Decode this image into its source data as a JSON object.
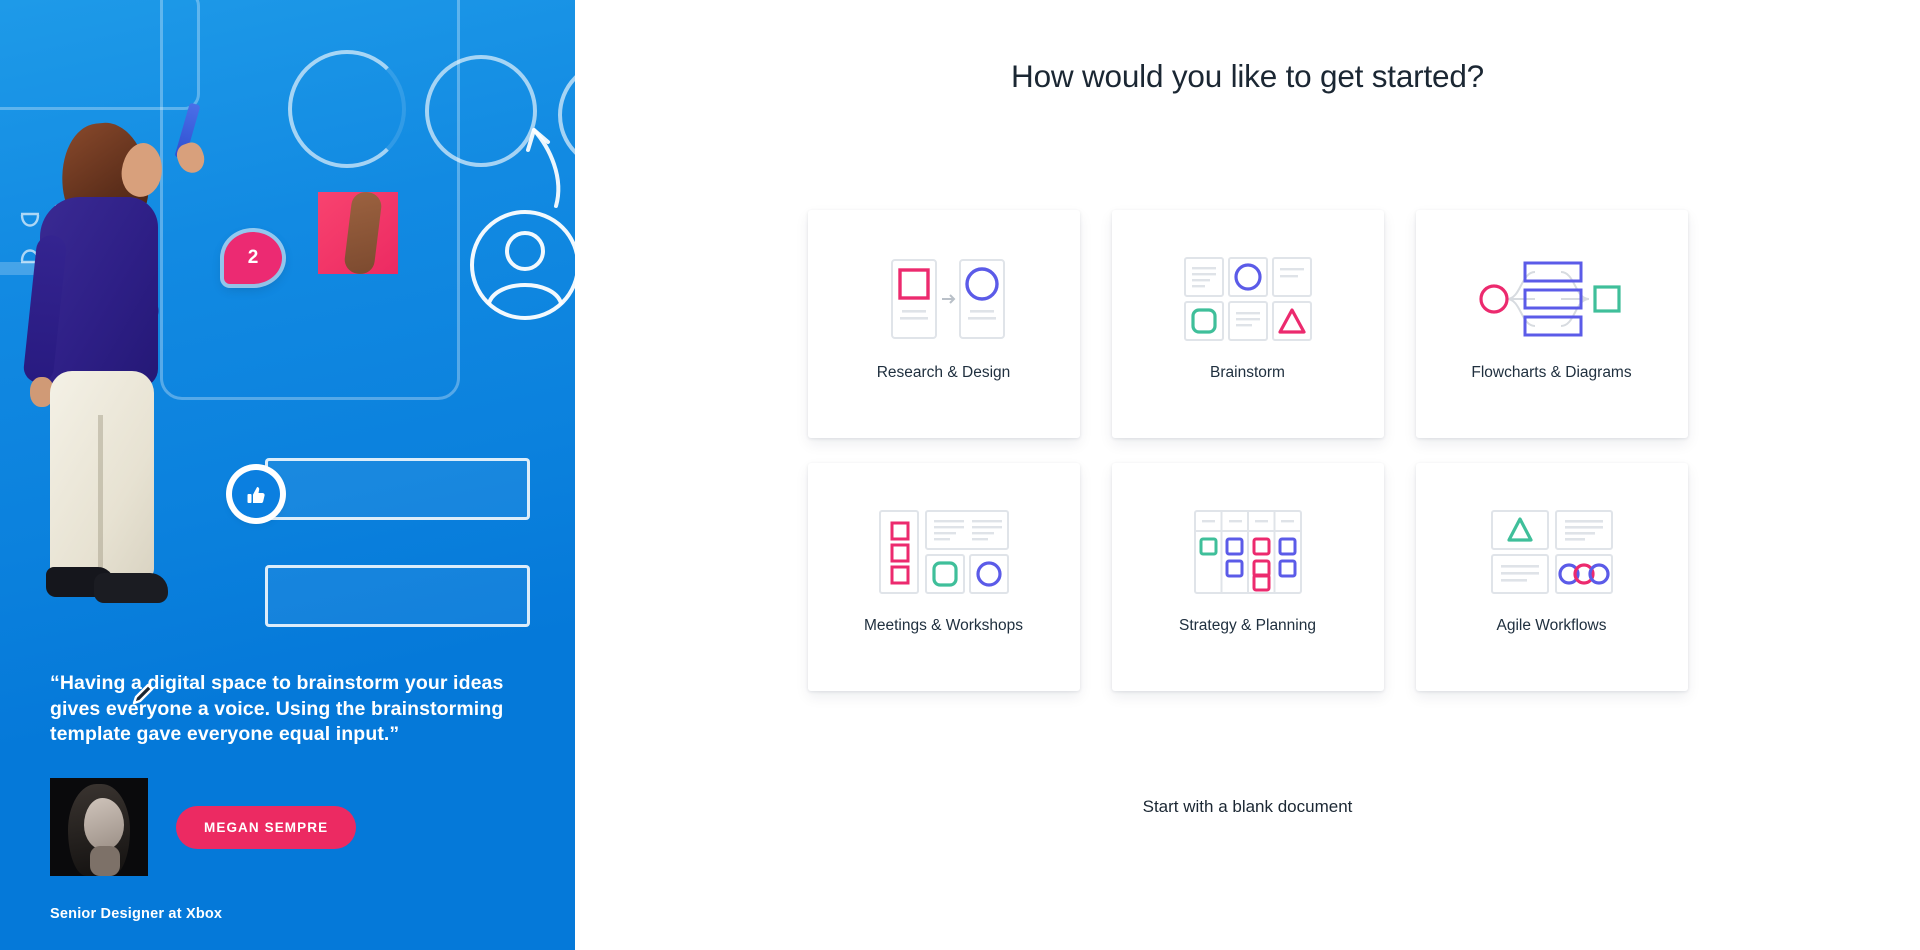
{
  "hero": {
    "comment_badge_count": "2",
    "thumbs_up_icon": "thumbs-up-icon",
    "avatar_outline_icon": "user-avatar-outline-icon",
    "pencil_icon": "pencil-edit-icon",
    "quote": "“Having a digital space to brainstorm your ideas gives everyone a voice. Using the brainstorming template gave everyone equal input.”",
    "author_name": "MEGAN SEMPRE",
    "author_role": "Senior Designer at Xbox",
    "colors": {
      "bg_top": "#1e9ae8",
      "bg_bottom": "#0579d9",
      "accent_pink": "#ec2a62",
      "badge_blue": "#0b7fe0"
    }
  },
  "main": {
    "title": "How would you like to get started?",
    "blank_document_label": "Start with a blank document",
    "colors": {
      "pink": "#ec2a6e",
      "blue": "#5b5be8",
      "teal": "#3fbf9a",
      "gray_line": "#d8dde3",
      "card_border": "#e3e7ec",
      "text": "#20303f"
    },
    "cards": [
      {
        "id": "research-design",
        "label": "Research & Design",
        "icon": "research-design-icon"
      },
      {
        "id": "brainstorm",
        "label": "Brainstorm",
        "icon": "brainstorm-icon"
      },
      {
        "id": "flowcharts-diagrams",
        "label": "Flowcharts & Diagrams",
        "icon": "flowchart-icon"
      },
      {
        "id": "meetings-workshops",
        "label": "Meetings & Workshops",
        "icon": "meetings-icon"
      },
      {
        "id": "strategy-planning",
        "label": "Strategy & Planning",
        "icon": "strategy-icon"
      },
      {
        "id": "agile-workflows",
        "label": "Agile Workflows",
        "icon": "agile-icon"
      }
    ]
  }
}
